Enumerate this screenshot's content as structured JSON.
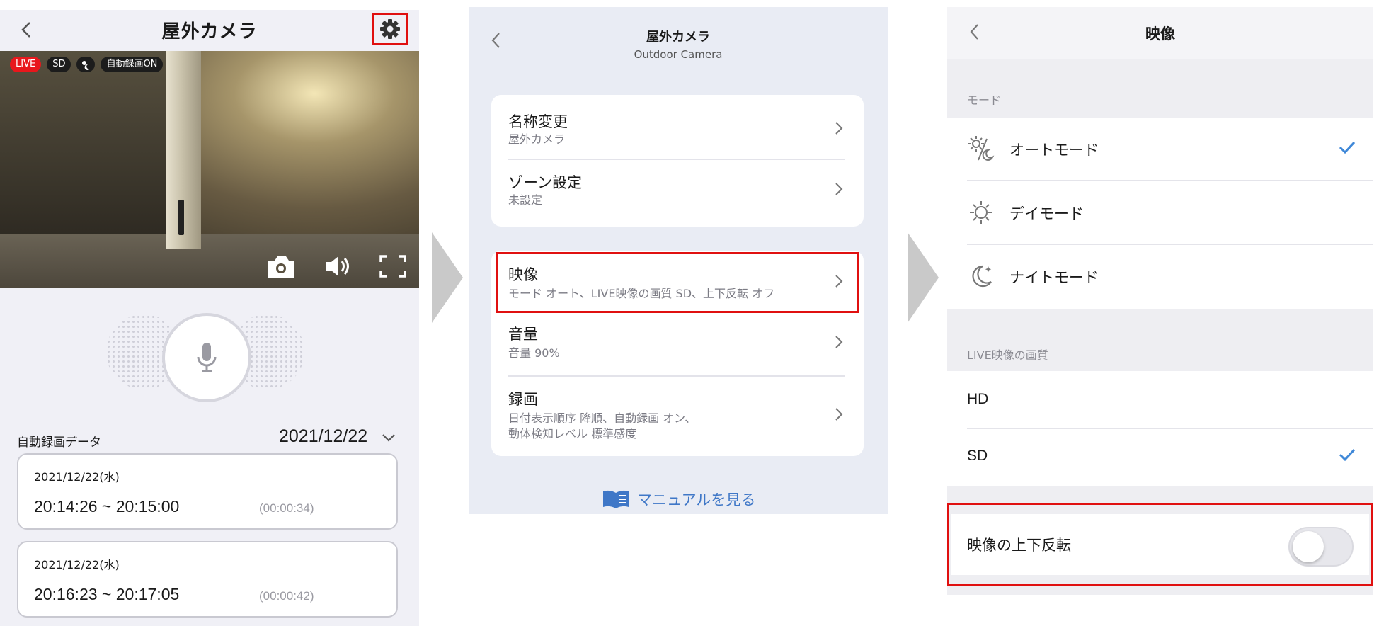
{
  "screen1": {
    "title": "屋外カメラ",
    "badges": {
      "live": "LIVE",
      "quality": "SD",
      "auto_record": "自動録画ON"
    },
    "record_label": "自動録画データ",
    "record_date": "2021/12/22",
    "records": [
      {
        "date": "2021/12/22(水)",
        "time": "20:14:26 ~ 20:15:00",
        "duration": "(00:00:34)"
      },
      {
        "date": "2021/12/22(水)",
        "time": "20:16:23 ~ 20:17:05",
        "duration": "(00:00:42)"
      }
    ]
  },
  "screen2": {
    "title": "屋外カメラ",
    "subtitle": "Outdoor Camera",
    "group1": [
      {
        "title": "名称変更",
        "sub": "屋外カメラ"
      },
      {
        "title": "ゾーン設定",
        "sub": "未設定"
      }
    ],
    "group2": [
      {
        "title": "映像",
        "sub": "モード オート、LIVE映像の画質 SD、上下反転 オフ"
      },
      {
        "title": "音量",
        "sub": "音量 90%"
      },
      {
        "title": "録画",
        "sub": "日付表示順序 降順、自動録画 オン、\n動体検知レベル 標準感度"
      }
    ],
    "manual_link": "マニュアルを見る"
  },
  "screen3": {
    "title": "映像",
    "mode_section": "モード",
    "modes": [
      {
        "label": "オートモード",
        "icon": "auto-mode-icon",
        "selected": true
      },
      {
        "label": "デイモード",
        "icon": "sun-icon",
        "selected": false
      },
      {
        "label": "ナイトモード",
        "icon": "moon-icon",
        "selected": false
      }
    ],
    "quality_section": "LIVE映像の画質",
    "qualities": [
      {
        "label": "HD",
        "selected": false
      },
      {
        "label": "SD",
        "selected": true
      }
    ],
    "flip_label": "映像の上下反転",
    "flip_on": false
  },
  "colors": {
    "highlight": "#e01010",
    "accent": "#3f88d8",
    "live": "#e8171c"
  }
}
